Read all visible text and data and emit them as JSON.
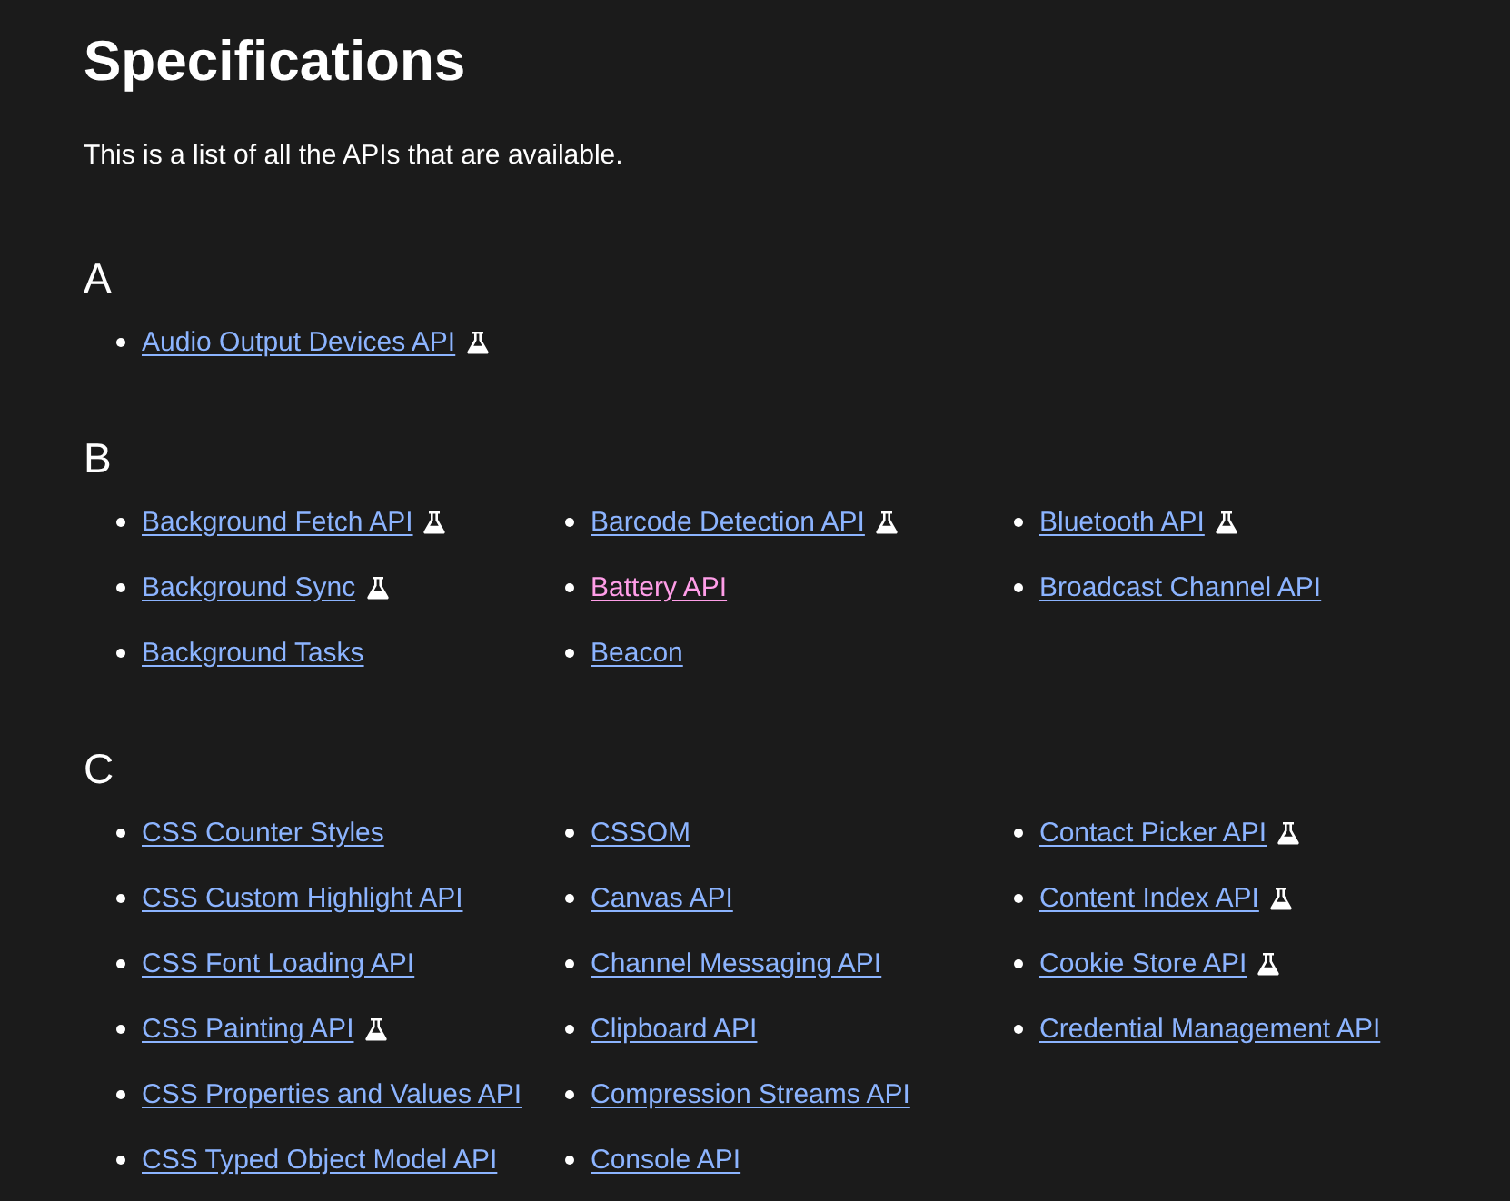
{
  "title": "Specifications",
  "intro": "This is a list of all the APIs that are available.",
  "sections": [
    {
      "letter": "A",
      "items": [
        {
          "label": "Audio Output Devices API",
          "experimental": true,
          "visited": false
        }
      ]
    },
    {
      "letter": "B",
      "items": [
        {
          "label": "Background Fetch API",
          "experimental": true,
          "visited": false
        },
        {
          "label": "Background Sync",
          "experimental": true,
          "visited": false
        },
        {
          "label": "Background Tasks",
          "experimental": false,
          "visited": false
        },
        {
          "label": "Barcode Detection API",
          "experimental": true,
          "visited": false
        },
        {
          "label": "Battery API",
          "experimental": false,
          "visited": true
        },
        {
          "label": "Beacon",
          "experimental": false,
          "visited": false
        },
        {
          "label": "Bluetooth API",
          "experimental": true,
          "visited": false
        },
        {
          "label": "Broadcast Channel API",
          "experimental": false,
          "visited": false
        }
      ]
    },
    {
      "letter": "C",
      "items": [
        {
          "label": "CSS Counter Styles",
          "experimental": false,
          "visited": false
        },
        {
          "label": "CSS Custom Highlight API",
          "experimental": false,
          "visited": false
        },
        {
          "label": "CSS Font Loading API",
          "experimental": false,
          "visited": false
        },
        {
          "label": "CSS Painting API",
          "experimental": true,
          "visited": false
        },
        {
          "label": "CSS Properties and Values API",
          "experimental": false,
          "visited": false
        },
        {
          "label": "CSS Typed Object Model API",
          "experimental": false,
          "visited": false
        },
        {
          "label": "CSSOM",
          "experimental": false,
          "visited": false
        },
        {
          "label": "Canvas API",
          "experimental": false,
          "visited": false
        },
        {
          "label": "Channel Messaging API",
          "experimental": false,
          "visited": false
        },
        {
          "label": "Clipboard API",
          "experimental": false,
          "visited": false
        },
        {
          "label": "Compression Streams API",
          "experimental": false,
          "visited": false
        },
        {
          "label": "Console API",
          "experimental": false,
          "visited": false
        },
        {
          "label": "Contact Picker API",
          "experimental": true,
          "visited": false
        },
        {
          "label": "Content Index API",
          "experimental": true,
          "visited": false
        },
        {
          "label": "Cookie Store API",
          "experimental": true,
          "visited": false
        },
        {
          "label": "Credential Management API",
          "experimental": false,
          "visited": false
        }
      ]
    }
  ]
}
